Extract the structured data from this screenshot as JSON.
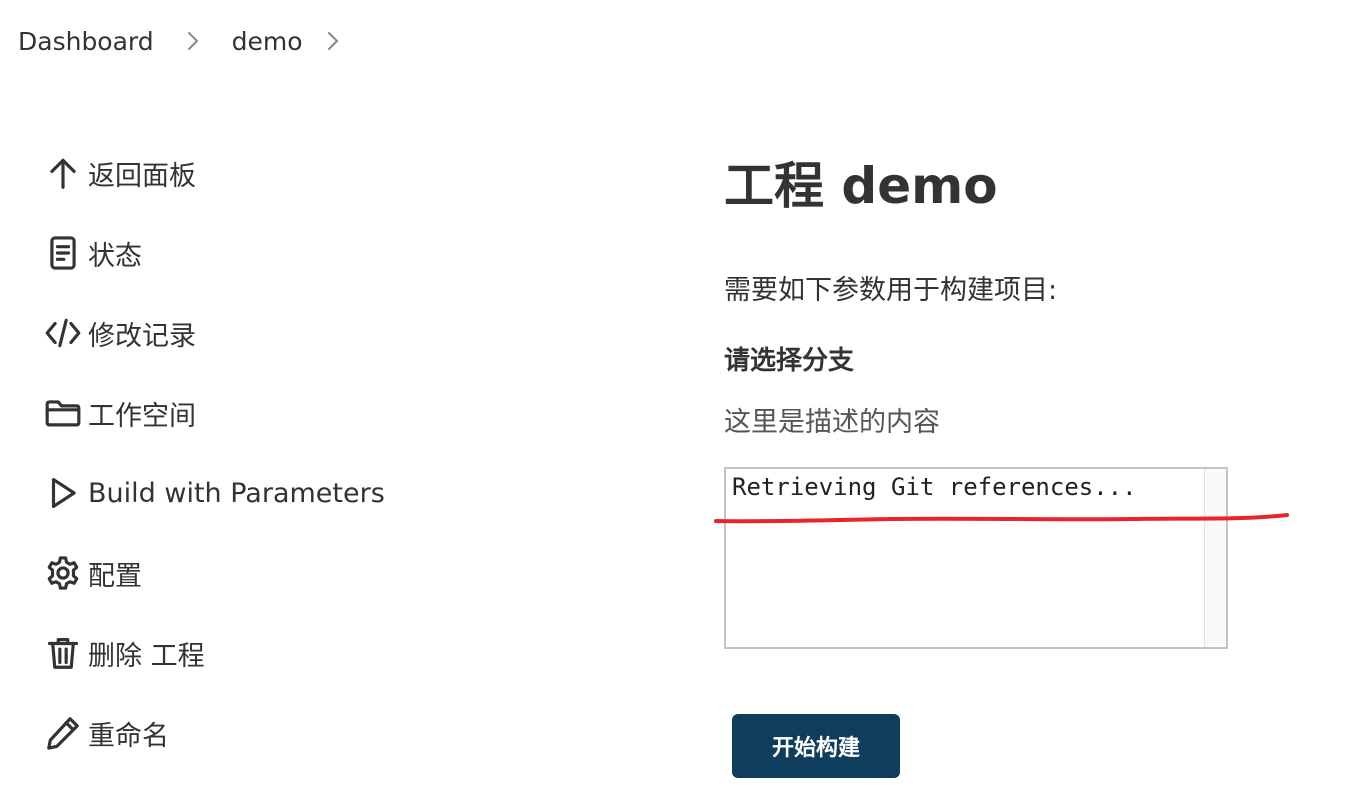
{
  "breadcrumb": {
    "items": [
      {
        "label": "Dashboard"
      },
      {
        "label": "demo"
      }
    ]
  },
  "sidebar": {
    "items": [
      {
        "label": "返回面板",
        "icon": "arrow-up-icon"
      },
      {
        "label": "状态",
        "icon": "document-icon"
      },
      {
        "label": "修改记录",
        "icon": "code-icon"
      },
      {
        "label": "工作空间",
        "icon": "folder-icon"
      },
      {
        "label": "Build with Parameters",
        "icon": "play-icon"
      },
      {
        "label": "配置",
        "icon": "gear-icon"
      },
      {
        "label": "删除 工程",
        "icon": "trash-icon"
      },
      {
        "label": "重命名",
        "icon": "pencil-icon"
      }
    ]
  },
  "main": {
    "title": "工程 demo",
    "intro": "需要如下参数用于构建项目:",
    "parameter": {
      "name": "请选择分支",
      "description": "这里是描述的内容",
      "options": [
        "Retrieving Git references..."
      ]
    },
    "build_button": "开始构建"
  },
  "colors": {
    "button_bg": "#0f3d5c",
    "annotation": "#e8262a",
    "text": "#333333"
  }
}
